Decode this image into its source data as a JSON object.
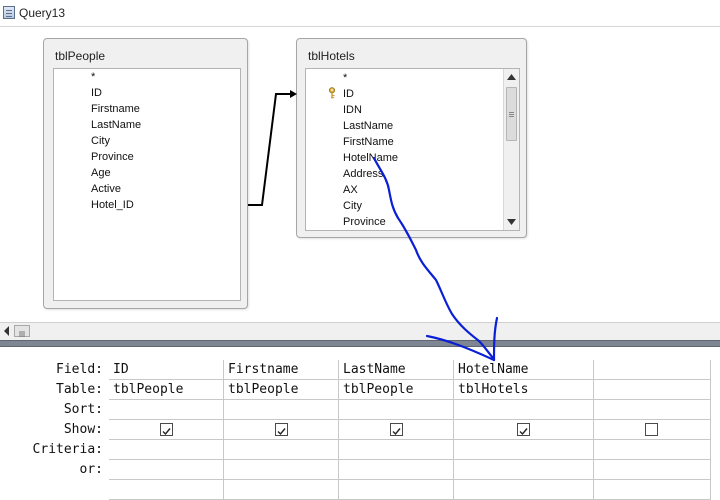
{
  "window": {
    "title": "Query13",
    "icon": "query-icon"
  },
  "tables": [
    {
      "name": "tblPeople",
      "fields": [
        "*",
        "ID",
        "Firstname",
        "LastName",
        "City",
        "Province",
        "Age",
        "Active",
        "Hotel_ID"
      ]
    },
    {
      "name": "tblHotels",
      "key_field": "ID",
      "fields": [
        "*",
        "ID",
        "IDN",
        "LastName",
        "FirstName",
        "HotelName",
        "Address",
        "AX",
        "City",
        "Province"
      ]
    }
  ],
  "grid": {
    "row_labels": [
      "Field:",
      "Table:",
      "Sort:",
      "Show:",
      "Criteria:",
      "or:"
    ],
    "columns": [
      {
        "field": "ID",
        "table": "tblPeople",
        "show": true
      },
      {
        "field": "Firstname",
        "table": "tblPeople",
        "show": true
      },
      {
        "field": "LastName",
        "table": "tblPeople",
        "show": true
      },
      {
        "field": "HotelName",
        "table": "tblHotels",
        "show": true
      },
      {
        "field": "",
        "table": "",
        "show": false
      }
    ]
  },
  "colors": {
    "annotation_ink": "#0b1fd4",
    "splitter": "#7d8692",
    "join_line": "#000000"
  }
}
